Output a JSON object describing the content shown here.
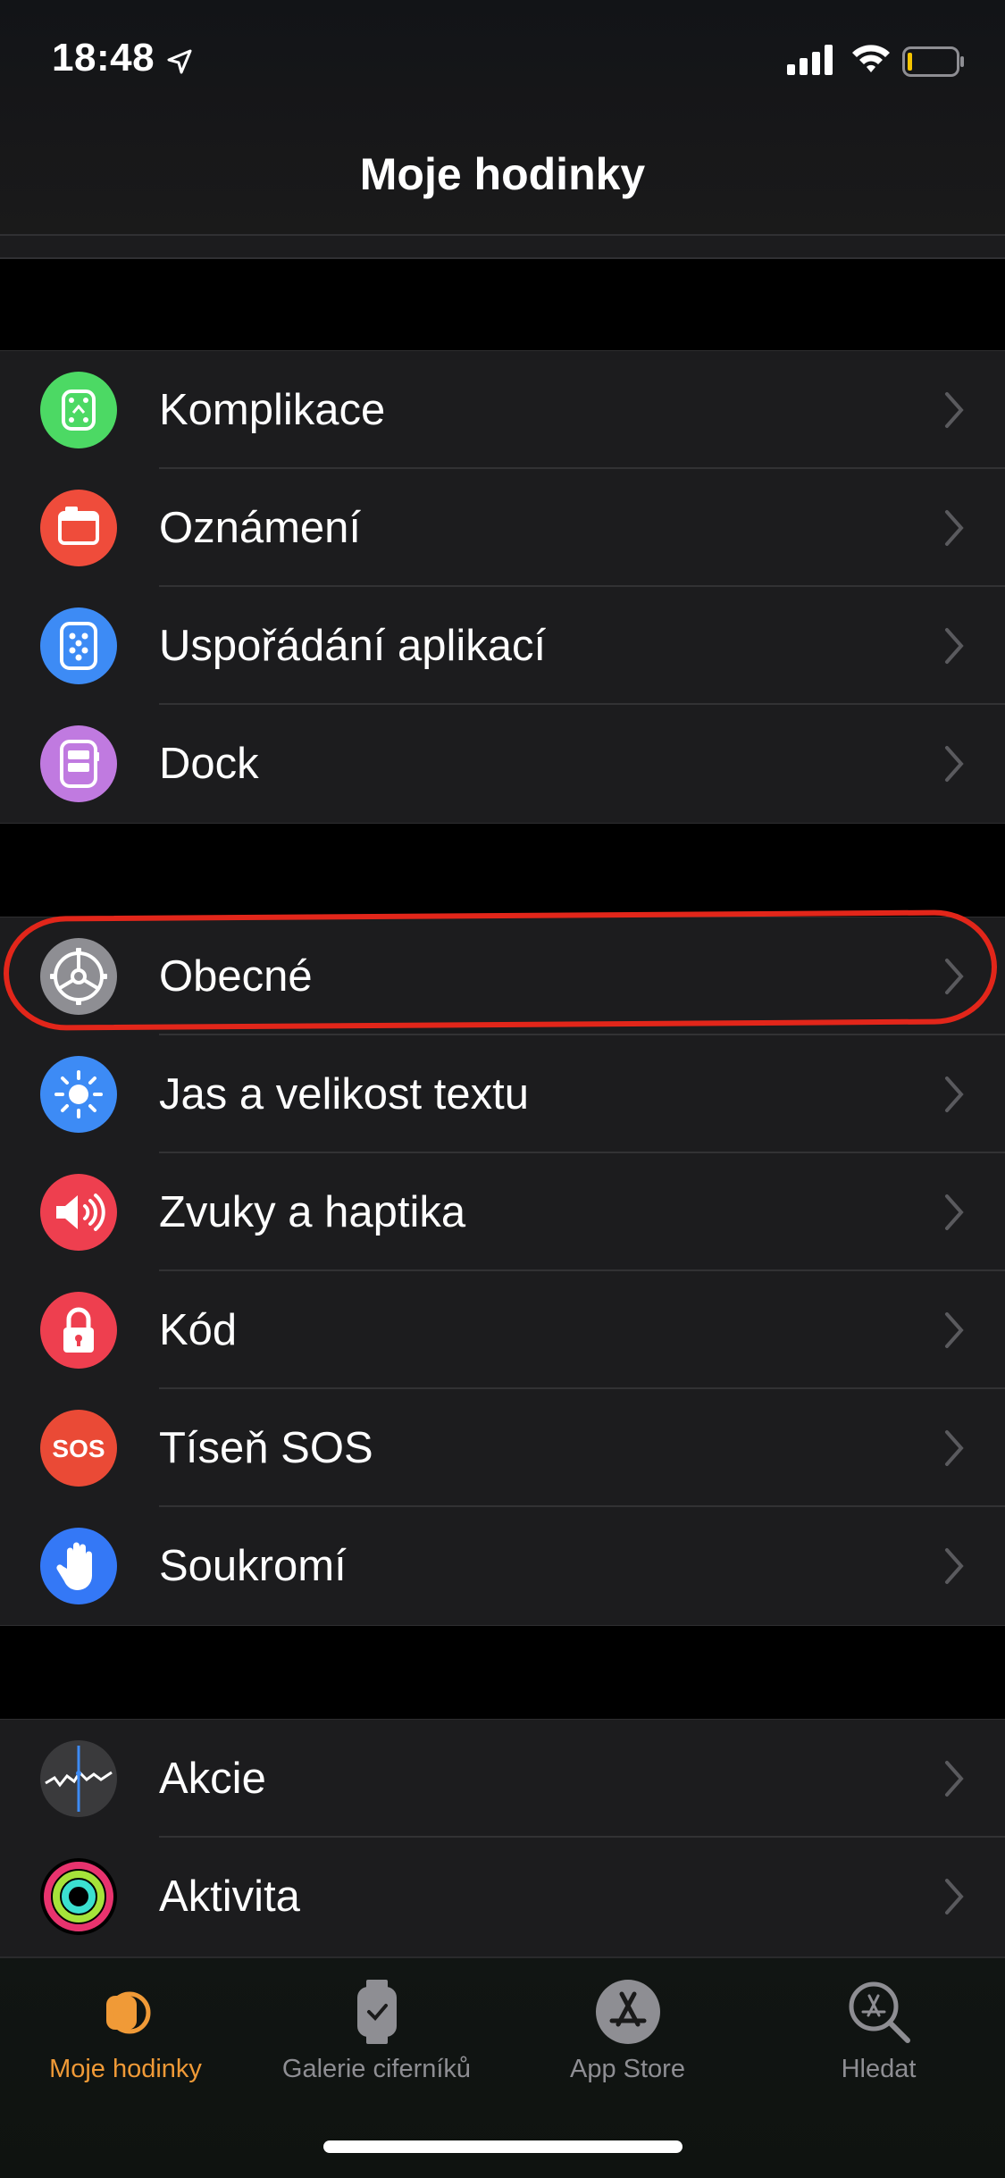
{
  "status_bar": {
    "time": "18:48"
  },
  "header": {
    "title": "Moje hodinky"
  },
  "group1": [
    {
      "label": "Komplikace",
      "icon": "complications-icon",
      "color": "#4cd964"
    },
    {
      "label": "Oznámení",
      "icon": "notifications-icon",
      "color": "#ef4c3b"
    },
    {
      "label": "Uspořádání aplikací",
      "icon": "app-layout-icon",
      "color": "#3d8bf5"
    },
    {
      "label": "Dock",
      "icon": "dock-icon",
      "color": "#c07ae0"
    }
  ],
  "group2": [
    {
      "label": "Obecné",
      "icon": "gear-icon",
      "color": "#8e8e93"
    },
    {
      "label": "Jas a velikost textu",
      "icon": "sun-icon",
      "color": "#3d8bf5"
    },
    {
      "label": "Zvuky a haptika",
      "icon": "speaker-icon",
      "color": "#ee3f4f"
    },
    {
      "label": "Kód",
      "icon": "lock-icon",
      "color": "#ee3f4f"
    },
    {
      "label": "Tíseň SOS",
      "icon": "sos-icon",
      "color": "#ea4a36",
      "icon_text": "SOS"
    },
    {
      "label": "Soukromí",
      "icon": "hand-icon",
      "color": "#3478f6"
    }
  ],
  "group3": [
    {
      "label": "Akcie",
      "icon": "stocks-icon",
      "color": "#3a3a3c"
    },
    {
      "label": "Aktivita",
      "icon": "activity-rings-icon",
      "color": "#000000"
    }
  ],
  "tabbar": {
    "tabs": [
      {
        "label": "Moje hodinky",
        "icon": "watch-icon",
        "active": true
      },
      {
        "label": "Galerie ciferníků",
        "icon": "watch-face-gallery-icon",
        "active": false
      },
      {
        "label": "App Store",
        "icon": "app-store-icon",
        "active": false
      },
      {
        "label": "Hledat",
        "icon": "search-icon",
        "active": false
      }
    ]
  },
  "colors": {
    "accent": "#f09a37",
    "inactive_tab": "#8e8e93",
    "highlight": "#e2261a"
  }
}
